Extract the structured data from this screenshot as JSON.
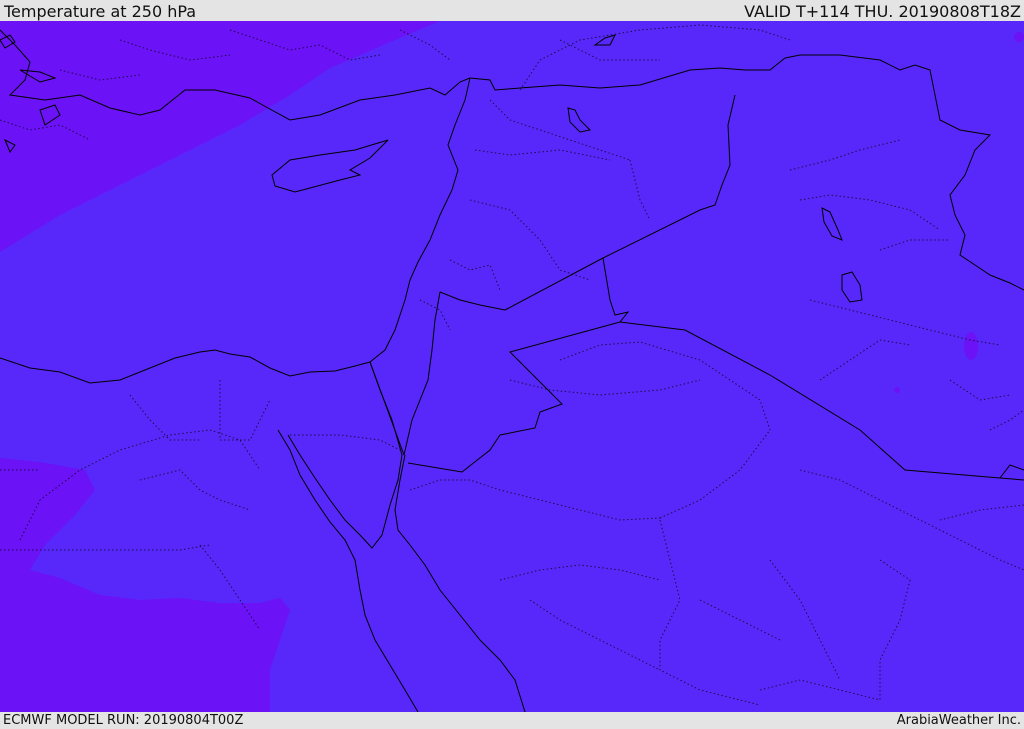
{
  "header": {
    "title": "Temperature at 250 hPa",
    "valid_time": "VALID T+114 THU. 20190808T18Z"
  },
  "footer": {
    "model_run": "ECMWF MODEL RUN: 20190804T00Z",
    "credit": "ArabiaWeather Inc."
  },
  "colors": {
    "field_main": "#5828fa",
    "field_cold": "#6b12f6",
    "boundary_line": "#000000",
    "bar_background": "#e4e4e4"
  }
}
